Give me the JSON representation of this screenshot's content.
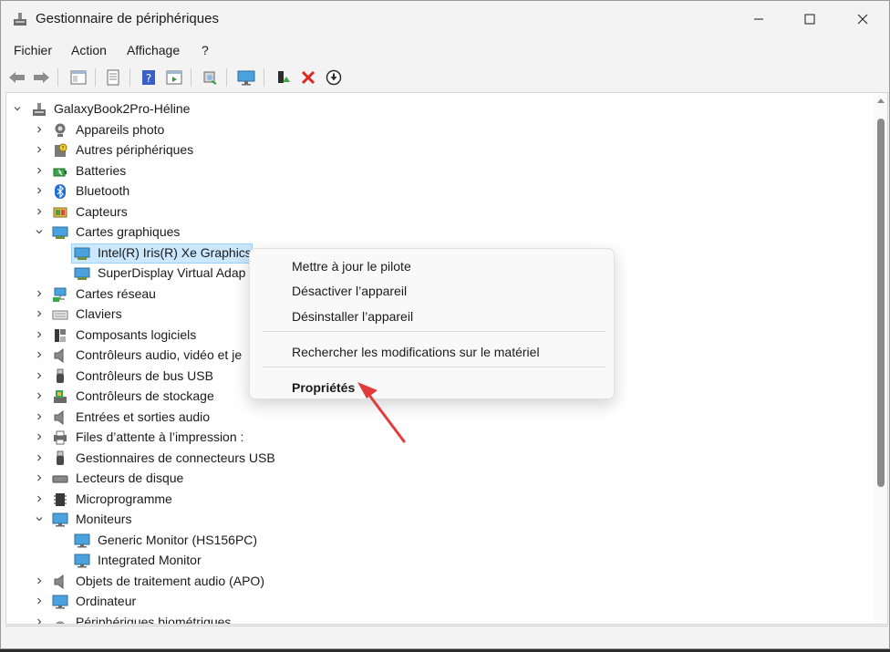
{
  "window": {
    "title": "Gestionnaire de périphériques"
  },
  "menu": [
    "Fichier",
    "Action",
    "Affichage",
    "?"
  ],
  "tree": {
    "root": "GalaxyBook2Pro-Héline",
    "items": [
      {
        "label": "Appareils photo",
        "icon": "camera-icon",
        "state": "collapsed"
      },
      {
        "label": "Autres périphériques",
        "icon": "unknown-device-icon",
        "state": "collapsed"
      },
      {
        "label": "Batteries",
        "icon": "battery-icon",
        "state": "collapsed"
      },
      {
        "label": "Bluetooth",
        "icon": "bluetooth-icon",
        "state": "collapsed"
      },
      {
        "label": "Capteurs",
        "icon": "sensor-icon",
        "state": "collapsed"
      },
      {
        "label": "Cartes graphiques",
        "icon": "display-adapter-icon",
        "state": "expanded"
      },
      {
        "label": "Intel(R) Iris(R) Xe Graphics",
        "icon": "display-adapter-icon",
        "child": true,
        "selected": true
      },
      {
        "label": "SuperDisplay Virtual Adap",
        "icon": "display-adapter-icon",
        "child": true
      },
      {
        "label": "Cartes réseau",
        "icon": "network-icon",
        "state": "collapsed"
      },
      {
        "label": "Claviers",
        "icon": "keyboard-icon",
        "state": "collapsed"
      },
      {
        "label": "Composants logiciels",
        "icon": "software-component-icon",
        "state": "collapsed"
      },
      {
        "label": "Contrôleurs audio, vidéo et je",
        "icon": "speaker-icon",
        "state": "collapsed"
      },
      {
        "label": "Contrôleurs de bus USB",
        "icon": "usb-icon",
        "state": "collapsed"
      },
      {
        "label": "Contrôleurs de stockage",
        "icon": "storage-controller-icon",
        "state": "collapsed"
      },
      {
        "label": "Entrées et sorties audio",
        "icon": "speaker-icon",
        "state": "collapsed"
      },
      {
        "label": "Files d’attente à l’impression :",
        "icon": "printer-icon",
        "state": "collapsed"
      },
      {
        "label": "Gestionnaires de connecteurs USB",
        "icon": "usb-icon",
        "state": "collapsed"
      },
      {
        "label": "Lecteurs de disque",
        "icon": "disk-drive-icon",
        "state": "collapsed"
      },
      {
        "label": "Microprogramme",
        "icon": "firmware-icon",
        "state": "collapsed"
      },
      {
        "label": "Moniteurs",
        "icon": "monitor-icon",
        "state": "expanded"
      },
      {
        "label": "Generic Monitor (HS156PC)",
        "icon": "monitor-icon",
        "child": true
      },
      {
        "label": "Integrated Monitor",
        "icon": "monitor-icon",
        "child": true
      },
      {
        "label": "Objets de traitement audio (APO)",
        "icon": "speaker-icon",
        "state": "collapsed"
      },
      {
        "label": "Ordinateur",
        "icon": "monitor-icon",
        "state": "collapsed"
      },
      {
        "label": "Périphériques biométriques",
        "icon": "fingerprint-icon",
        "state": "collapsed"
      }
    ]
  },
  "context_menu": {
    "update_driver": "Mettre à jour le pilote",
    "disable_device": "Désactiver l’appareil",
    "uninstall_device": "Désinstaller l’appareil",
    "scan_hardware": "Rechercher les modifications sur le matériel",
    "properties": "Propriétés"
  },
  "colors": {
    "selection": "#cce8ff",
    "arrow": "#e03c3c",
    "accent": "#1e6fd9"
  }
}
